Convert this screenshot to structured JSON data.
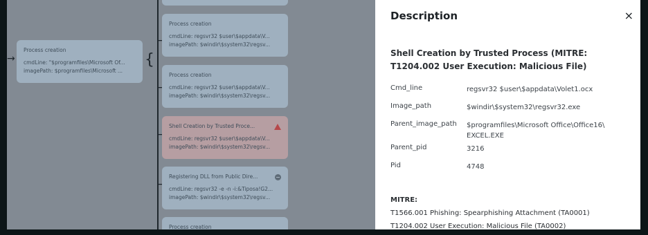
{
  "graph": {
    "root_node": {
      "title": "Process creation",
      "lines": [
        "cmdLine: \"$programfiles\\Microsoft Of...",
        "imagePath: $programfiles\\Microsoft ..."
      ]
    },
    "child_nodes": [
      {
        "title": "Process creation",
        "lines": [
          "cmdLine: regsvr32 $user\\$appdata\\V...",
          "imagePath: $windir\\$system32\\regsv..."
        ],
        "badge": ""
      },
      {
        "title": "Process creation",
        "lines": [
          "cmdLine: regsvr32 $user\\$appdata\\V...",
          "imagePath: $windir\\$system32\\regsv..."
        ],
        "badge": ""
      },
      {
        "title": "Shell Creation by Trusted Proce...",
        "lines": [
          "cmdLine: regsvr32 $user\\$appdata\\V...",
          "imagePath: $windir\\$system32\\regsv..."
        ],
        "badge": "warning-icon"
      },
      {
        "title": "Registering DLL from Public Dire...",
        "lines": [
          "cmdLine: regsvr32 -e -n -i:&Tiposa!G2...",
          "imagePath: $windir\\$system32\\regsv..."
        ],
        "badge": "minus-circle-icon"
      },
      {
        "title": "Process creation",
        "lines": [],
        "badge": ""
      }
    ]
  },
  "panel": {
    "header": "Description",
    "close_glyph": "×",
    "title": "Shell Creation by Trusted Process (MITRE: T1204.002 User Execution: Malicious File)",
    "fields": [
      {
        "key": "Cmd_line",
        "value": "regsvr32 $user\\$appdata\\Volet1.ocx"
      },
      {
        "key": "Image_path",
        "value": "$windir\\$system32\\regsvr32.exe"
      },
      {
        "key": "Parent_image_path",
        "value": "$programfiles\\Microsoft Office\\Office16\\ EXCEL.EXE"
      },
      {
        "key": "Parent_pid",
        "value": "3216"
      },
      {
        "key": "Pid",
        "value": "4748"
      }
    ],
    "mitre_heading": "MITRE:",
    "mitre_items": [
      "T1566.001 Phishing: Spearphishing Attachment (TA0001)",
      "T1204.002 User Execution: Malicious File (TA0002)"
    ]
  },
  "colors": {
    "overlay": "#828a93",
    "node": "#9fb0bf",
    "node_warning": "#b69ea2",
    "warning_accent": "#b6484a",
    "panel_bg": "#ffffff"
  }
}
